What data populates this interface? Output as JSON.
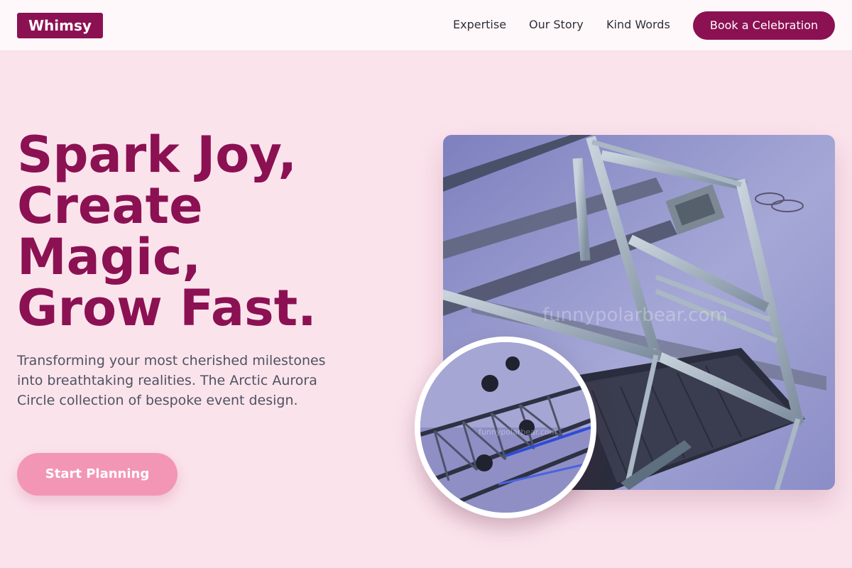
{
  "brand": {
    "logo": "Whimsy"
  },
  "nav": {
    "links": [
      {
        "label": "Expertise"
      },
      {
        "label": "Our Story"
      },
      {
        "label": "Kind Words"
      }
    ],
    "cta_label": "Book a Celebration"
  },
  "hero": {
    "title_lines": [
      "Spark Joy,",
      "Create",
      "Magic,",
      "Grow Fast."
    ],
    "subtitle": "Transforming your most cherished milestones into breathtaking realities. The Arctic Aurora Circle collection of bespoke event design.",
    "cta_label": "Start Planning"
  },
  "media": {
    "main_photo": {
      "subject": "steel truss lighting rig",
      "watermark": "funnypolarbear.com"
    },
    "circle_photo": {
      "subject": "stage lighting truss",
      "watermark": "funnypolarbear.com"
    }
  },
  "colors": {
    "brand": "#8b1153",
    "background": "#fbe3ec",
    "nav_background": "#fff8fa",
    "cta_pink": "#f396b6",
    "body_text": "#4f5361"
  }
}
